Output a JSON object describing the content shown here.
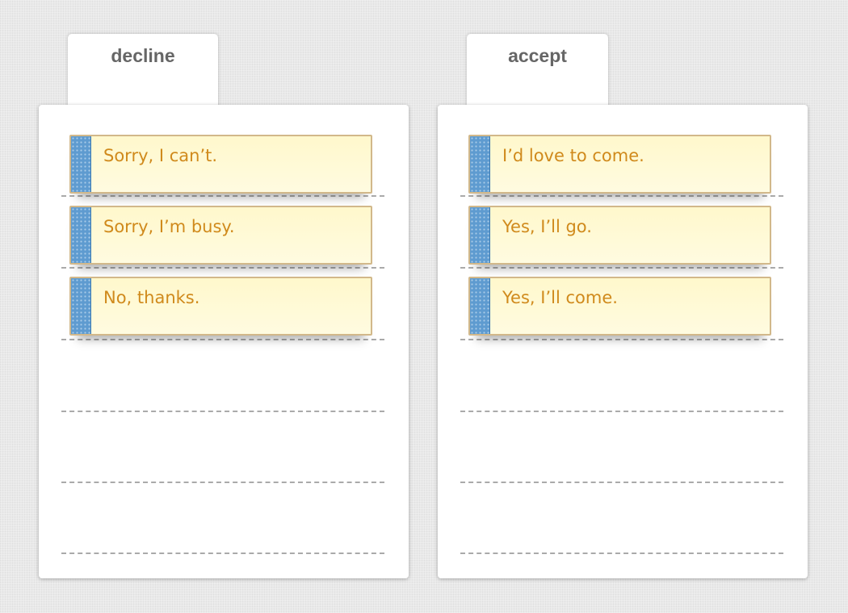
{
  "columns": [
    {
      "title": "decline",
      "items": [
        "Sorry, I can’t.",
        "Sorry, I’m busy.",
        "No, thanks."
      ]
    },
    {
      "title": "accept",
      "items": [
        "I’d love to come.",
        "Yes, I’ll go.",
        "Yes, I’ll come."
      ]
    }
  ]
}
